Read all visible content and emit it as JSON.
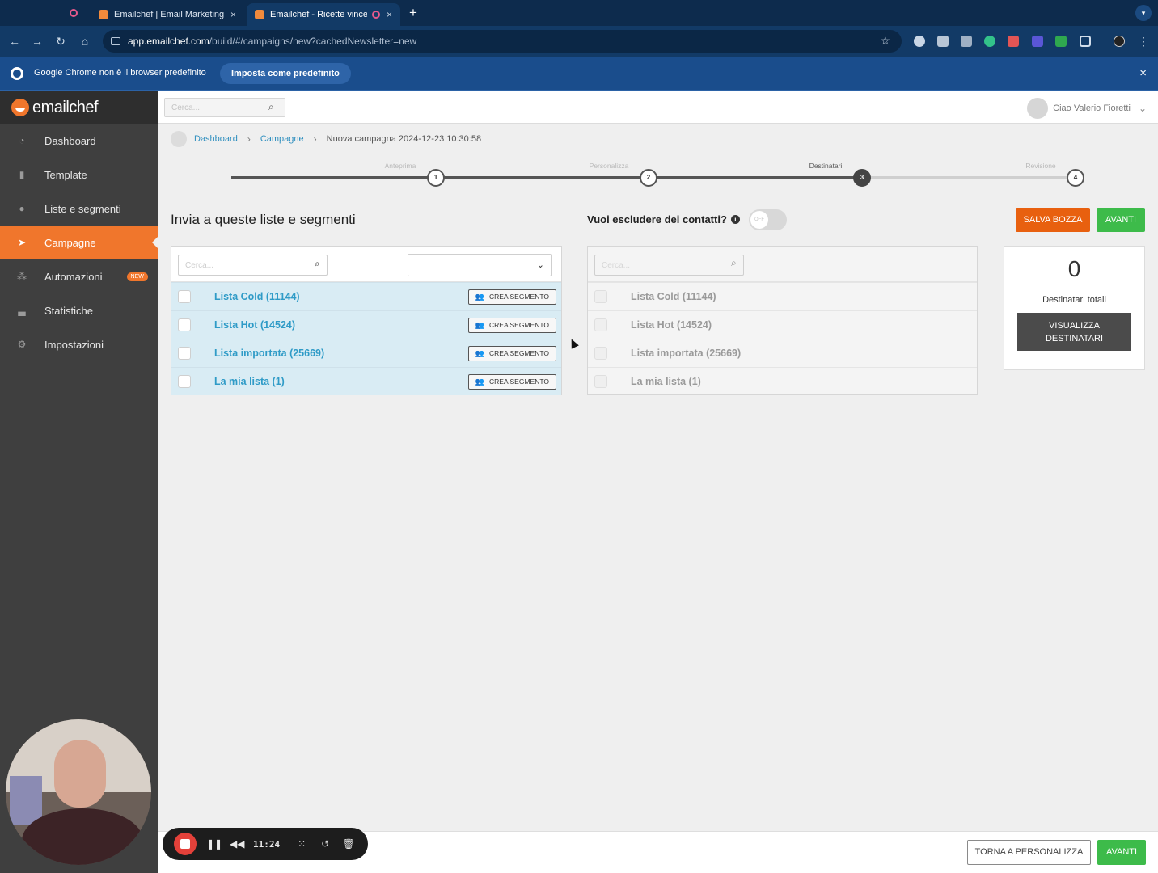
{
  "browser": {
    "tabs": [
      {
        "title": "Emailchef | Email Marketing A",
        "close": "×"
      },
      {
        "title": "Emailchef - Ricette vincenti",
        "close": "×"
      }
    ],
    "new_tab": "+",
    "url_host": "app.emailchef.com",
    "url_path": "/build/#/campaigns/new?cachedNewsletter=new",
    "infobar": {
      "message": "Google Chrome non è il browser predefinito",
      "button": "Imposta come predefinito",
      "close": "×"
    }
  },
  "brand": {
    "name": "emailchef",
    "accent": "#f0762c"
  },
  "sidebar": {
    "items": [
      {
        "label": "Dashboard",
        "icon": "gauge-icon",
        "glyph": "◔"
      },
      {
        "label": "Template",
        "icon": "document-icon",
        "glyph": "▮"
      },
      {
        "label": "Liste e segmenti",
        "icon": "users-icon",
        "glyph": "●"
      },
      {
        "label": "Campagne",
        "icon": "paper-plane-icon",
        "glyph": "➤",
        "active": true
      },
      {
        "label": "Automazioni",
        "icon": "network-icon",
        "glyph": "⁂",
        "badge": "NEW"
      },
      {
        "label": "Statistiche",
        "icon": "chart-icon",
        "glyph": "▃"
      },
      {
        "label": "Impostazioni",
        "icon": "gears-icon",
        "glyph": "⚙"
      }
    ]
  },
  "topbar": {
    "search_placeholder": "Cerca...",
    "user_greeting": "Ciao Valerio Fioretti"
  },
  "breadcrumb": {
    "items": [
      "Dashboard",
      "Campagne"
    ],
    "current": "Nuova campagna 2024-12-23 10:30:58"
  },
  "stepper": {
    "steps": [
      {
        "label": "Anteprima",
        "number": "1"
      },
      {
        "label": "Personalizza",
        "number": "2"
      },
      {
        "label": "Destinatari",
        "number": "3",
        "current": true
      },
      {
        "label": "Revisione",
        "number": "4"
      }
    ]
  },
  "main": {
    "lists_title": "Invia a queste liste e segmenti",
    "exclude_question": "Vuoi escludere dei contatti?",
    "exclude_toggle": "OFF",
    "save_draft": "SALVA BOZZA",
    "next": "AVANTI",
    "search_placeholder": "Cerca...",
    "create_segment": "CREA SEGMENTO",
    "lists": [
      {
        "name": "Lista Cold (11144)"
      },
      {
        "name": "Lista Hot (14524)"
      },
      {
        "name": "Lista importata (25669)"
      },
      {
        "name": "La mia lista (1)"
      }
    ]
  },
  "totals": {
    "count": "0",
    "label": "Destinatari totali",
    "view_button_line1": "VISUALIZZA",
    "view_button_line2": "DESTINATARI"
  },
  "footer": {
    "back": "TORNA A PERSONALIZZA",
    "next": "AVANTI"
  },
  "recorder": {
    "time": "11:24"
  }
}
